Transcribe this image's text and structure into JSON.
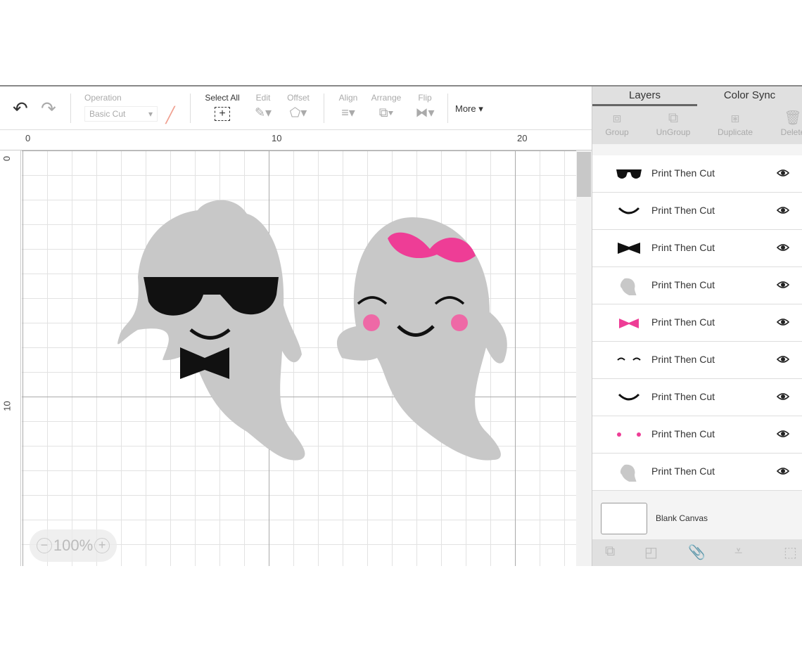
{
  "toolbar": {
    "undo": "undo",
    "redo": "redo",
    "operation_label": "Operation",
    "operation_value": "Basic Cut",
    "select_all": "Select All",
    "edit": "Edit",
    "offset": "Offset",
    "align": "Align",
    "arrange": "Arrange",
    "flip": "Flip",
    "more": "More ▾"
  },
  "ruler": {
    "h": [
      "0",
      "10",
      "20"
    ],
    "v": [
      "0",
      "10"
    ]
  },
  "zoom": {
    "value": "100%",
    "minus": "−",
    "plus": "+"
  },
  "panel": {
    "tabs": [
      "Layers",
      "Color Sync"
    ],
    "tools": [
      "Group",
      "UnGroup",
      "Duplicate",
      "Delete"
    ],
    "layers": [
      {
        "label": "Print Then Cut",
        "thumb": "sunglasses"
      },
      {
        "label": "Print Then Cut",
        "thumb": "smile"
      },
      {
        "label": "Print Then Cut",
        "thumb": "bowtie"
      },
      {
        "label": "Print Then Cut",
        "thumb": "ghost"
      },
      {
        "label": "Print Then Cut",
        "thumb": "pink-bow"
      },
      {
        "label": "Print Then Cut",
        "thumb": "eyelashes"
      },
      {
        "label": "Print Then Cut",
        "thumb": "smile"
      },
      {
        "label": "Print Then Cut",
        "thumb": "cheeks"
      },
      {
        "label": "Print Then Cut",
        "thumb": "ghost"
      }
    ],
    "blank_canvas": "Blank Canvas"
  },
  "colors": {
    "ghost": "#c8c8c8",
    "pink": "#ee3d96",
    "black": "#111111"
  }
}
